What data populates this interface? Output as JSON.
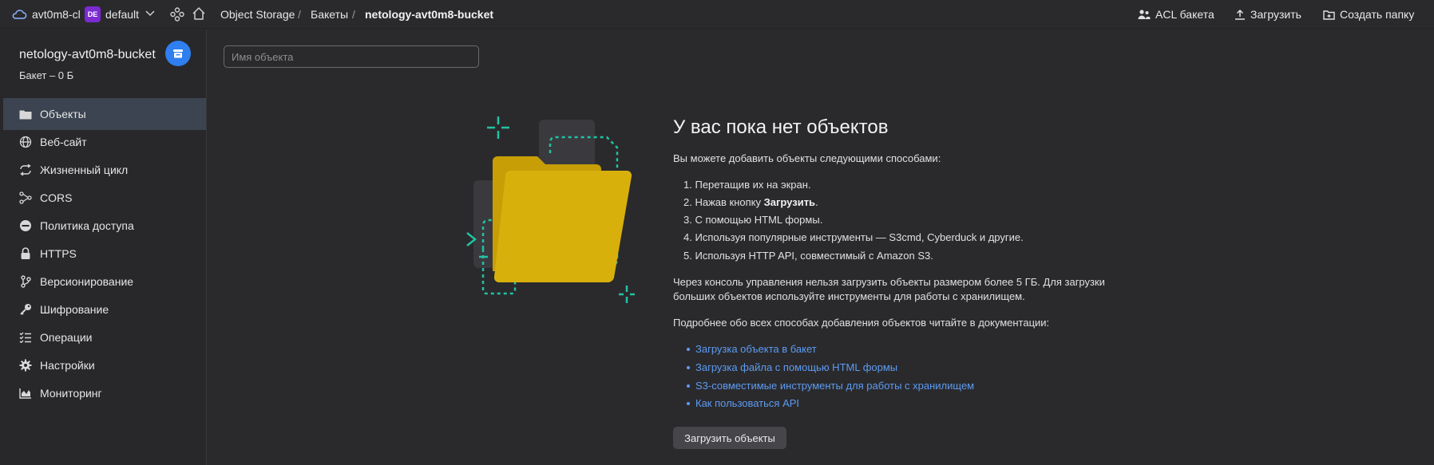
{
  "topbar": {
    "cloud_name": "avt0m8-cl",
    "folder_badge": "DE",
    "folder_name": "default",
    "breadcrumbs": [
      "Object Storage",
      "Бакеты",
      "netology-avt0m8-bucket"
    ],
    "actions": {
      "acl": "ACL бакета",
      "upload": "Загрузить",
      "create_folder": "Создать папку"
    }
  },
  "sidebar": {
    "bucket_name": "netology-avt0m8-bucket",
    "bucket_sub": "Бакет – 0 Б",
    "items": [
      {
        "label": "Объекты",
        "icon": "folder-icon"
      },
      {
        "label": "Веб-сайт",
        "icon": "globe-icon"
      },
      {
        "label": "Жизненный цикл",
        "icon": "cycle-icon"
      },
      {
        "label": "CORS",
        "icon": "cors-icon"
      },
      {
        "label": "Политика доступа",
        "icon": "no-entry-icon"
      },
      {
        "label": "HTTPS",
        "icon": "lock-icon"
      },
      {
        "label": "Версионирование",
        "icon": "branch-icon"
      },
      {
        "label": "Шифрование",
        "icon": "key-icon"
      },
      {
        "label": "Операции",
        "icon": "checklist-icon"
      },
      {
        "label": "Настройки",
        "icon": "gear-icon"
      },
      {
        "label": "Мониторинг",
        "icon": "monitoring-icon"
      }
    ]
  },
  "main": {
    "search_placeholder": "Имя объекта",
    "empty_title": "У вас пока нет объектов",
    "intro": "Вы можете добавить объекты следующими способами:",
    "methods": [
      {
        "num": "1.",
        "text": "Перетащив их на экран."
      },
      {
        "num": "2.",
        "text_before": "Нажав кнопку ",
        "bold": "Загрузить",
        "text_after": "."
      },
      {
        "num": "3.",
        "text": "С помощью HTML формы."
      },
      {
        "num": "4.",
        "text": "Используя популярные инструменты — S3cmd, Cyberduck и другие."
      },
      {
        "num": "5.",
        "text": "Используя HTTP API, совместимый с Amazon S3."
      }
    ],
    "note_line1": "Через консоль управления нельзя загрузить объекты размером более 5 ГБ. Для загрузки",
    "note_line2": "больших объектов используйте инструменты для работы с хранилищем.",
    "docs_intro": "Подробнее обо всех способах добавления объектов читайте в документации:",
    "links": [
      "Загрузка объекта в бакет",
      "Загрузка файла с помощью HTML формы",
      "S3-совместимые инструменты для работы с хранилищем",
      "Как пользоваться API"
    ],
    "upload_button": "Загрузить объекты"
  },
  "colors": {
    "accent": "#2f7ff0",
    "link": "#5e9bf0",
    "folder": "#d4aa0a",
    "teal": "#21c2a3",
    "active_item": "#3b4450"
  }
}
